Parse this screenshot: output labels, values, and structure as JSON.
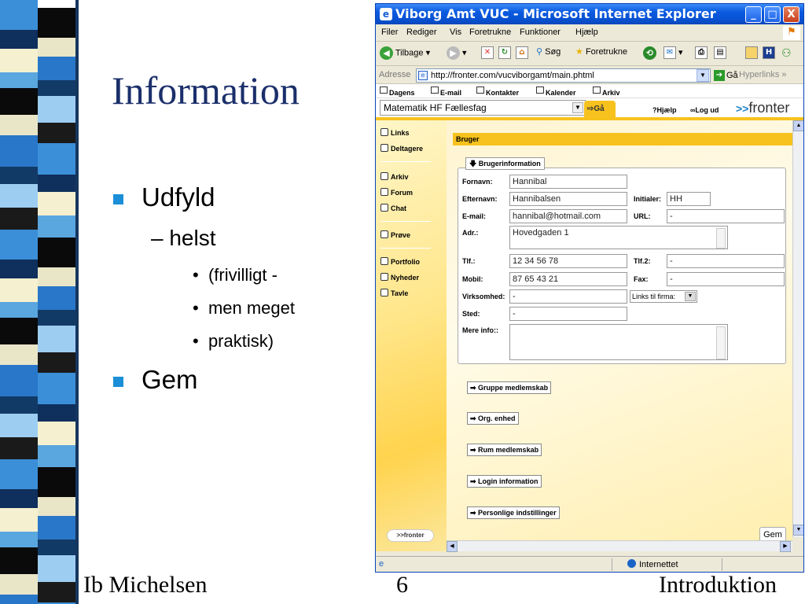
{
  "slide": {
    "title": "Information",
    "bullets": [
      {
        "text": "Udfyld"
      },
      {
        "text": "Gem"
      }
    ],
    "sub_bullet": "– helst",
    "sub_sub_bullets": [
      "(frivilligt -",
      "men meget",
      "praktisk)"
    ],
    "footer": {
      "left": "Ib Michelsen",
      "center": "6",
      "right": "Introduktion"
    }
  },
  "ie": {
    "title": "Viborg Amt VUC - Microsoft Internet Explorer",
    "window_buttons": [
      "_",
      "□",
      "X"
    ],
    "menu": [
      "Filer",
      "Rediger",
      "Vis",
      "Foretrukne",
      "Funktioner",
      "Hjælp"
    ],
    "toolbar": {
      "back": "Tilbage",
      "search": "Søg",
      "favorites": "Foretrukne"
    },
    "address": {
      "label": "Adresse",
      "url": "http://fronter.com/vucviborgamt/main.phtml",
      "go": "Gå",
      "links": "Hyperlinks"
    },
    "status": "Internettet"
  },
  "fronter": {
    "nav": [
      "Dagens",
      "E-mail",
      "Kontakter",
      "Kalender",
      "Arkiv"
    ],
    "room": "Matematik HF Fællesfag",
    "go": "Gå",
    "help": "Hjælp",
    "logout": "Log ud",
    "brand": "fronter",
    "left_menu": [
      {
        "label": "Links",
        "icon": "links-icon"
      },
      {
        "label": "Deltagere",
        "icon": "participants-icon"
      },
      {
        "label": "Arkiv",
        "icon": "folder-icon"
      },
      {
        "label": "Forum",
        "icon": "forum-icon"
      },
      {
        "label": "Chat",
        "icon": "chat-icon"
      },
      {
        "label": "Prøve",
        "icon": "test-icon"
      },
      {
        "label": "Portfolio",
        "icon": "portfolio-icon"
      },
      {
        "label": "Nyheder",
        "icon": "news-icon"
      },
      {
        "label": "Tavle",
        "icon": "board-icon"
      }
    ],
    "logo_small": "fronter",
    "section_header": "Bruger",
    "panel_title": "Brugerinformation",
    "form": {
      "fornavn": {
        "label": "Fornavn:",
        "value": "Hannibal"
      },
      "efternavn": {
        "label": "Efternavn:",
        "value": "Hannibalsen"
      },
      "initialer": {
        "label": "Initialer:",
        "value": "HH"
      },
      "email": {
        "label": "E-mail:",
        "value": "hannibal@hotmail.com"
      },
      "url": {
        "label": "URL:",
        "value": "-"
      },
      "adr": {
        "label": "Adr.:",
        "value": "Hovedgaden 1"
      },
      "tlf": {
        "label": "Tlf.:",
        "value": "12 34 56 78"
      },
      "tlf2": {
        "label": "Tlf.2:",
        "value": "-"
      },
      "mobil": {
        "label": "Mobil:",
        "value": "87 65 43 21"
      },
      "fax": {
        "label": "Fax:",
        "value": "-"
      },
      "virksomhed": {
        "label": "Virksomhed:",
        "value": "-"
      },
      "links_til_firma": "Links til firma:",
      "sted": {
        "label": "Sted:",
        "value": "-"
      },
      "mere_info": {
        "label": "Mere info::",
        "value": ""
      }
    },
    "sections": [
      "Gruppe medlemskab",
      "Org. enhed",
      "Rum medlemskab",
      "Login information",
      "Personlige indstillinger"
    ],
    "save_button": "Gem"
  },
  "colors": {
    "accent_yellow": "#f7c21e",
    "title_blue": "#1b2f6b",
    "bullet_blue": "#1a8fd8"
  }
}
